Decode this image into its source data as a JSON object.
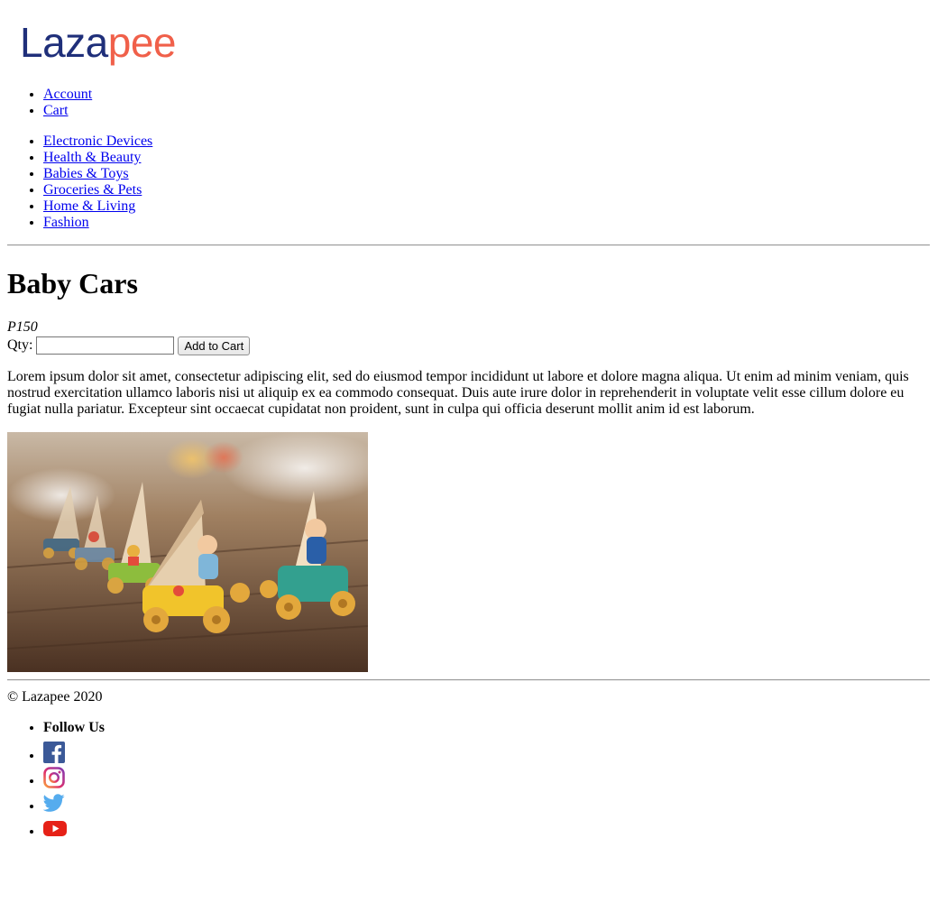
{
  "brand": {
    "logo_part1": "Laza",
    "logo_part2": "pee"
  },
  "account_nav": [
    {
      "label": "Account"
    },
    {
      "label": "Cart"
    }
  ],
  "categories": [
    {
      "label": "Electronic Devices"
    },
    {
      "label": "Health & Beauty"
    },
    {
      "label": "Babies & Toys"
    },
    {
      "label": "Groceries & Pets"
    },
    {
      "label": "Home & Living"
    },
    {
      "label": "Fashion"
    }
  ],
  "product": {
    "title": "Baby Cars",
    "price": "P150",
    "qty_label": "Qty:",
    "qty_value": "",
    "add_to_cart_label": "Add to Cart",
    "description": "Lorem ipsum dolor sit amet, consectetur adipiscing elit, sed do eiusmod tempor incididunt ut labore et dolore magna aliqua. Ut enim ad minim veniam, quis nostrud exercitation ullamco laboris nisi ut aliquip ex ea commodo consequat. Duis aute irure dolor in reprehenderit in voluptate velit esse cillum dolore eu fugiat nulla pariatur. Excepteur sint occaecat cupidatat non proident, sunt in culpa qui officia deserunt mollit anim id est laborum."
  },
  "footer": {
    "copyright": "© Lazapee 2020",
    "follow_label": "Follow Us",
    "social_icons": [
      "facebook-icon",
      "instagram-icon",
      "twitter-icon",
      "youtube-icon"
    ]
  },
  "colors": {
    "logo_blue": "#1f2f7a",
    "logo_orange": "#f0604a",
    "link": "#0000ee",
    "facebook": "#3b5998",
    "twitter": "#55acee",
    "youtube": "#e62117"
  }
}
